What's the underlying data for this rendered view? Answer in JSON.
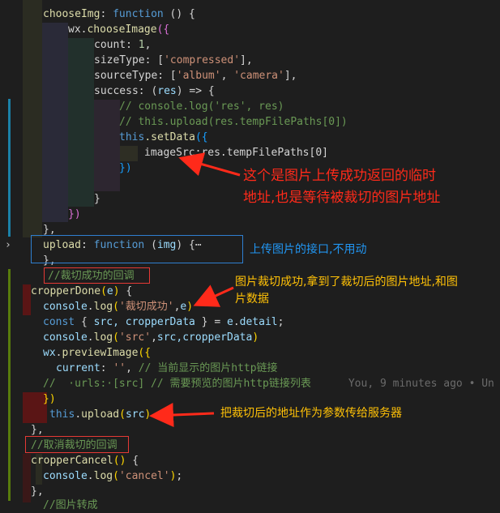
{
  "code": {
    "l1_name": "chooseImg",
    "l1_sep": ": ",
    "l1_kw": "function",
    "l1_rest": " () {",
    "l2_obj": "wx.",
    "l2_fn": "chooseImage",
    "l2_paren": "({",
    "l3_key": "count",
    "l3_val": "1",
    "l4_key": "sizeType",
    "l4_open": ": [",
    "l4_str": "'compressed'",
    "l4_close": "],",
    "l5_key": "sourceType",
    "l5_open": ": [",
    "l5_str1": "'album'",
    "l5_str2": "'camera'",
    "l5_close": "],",
    "l6_key": "success",
    "l6_sep": ": (",
    "l6_param": "res",
    "l6_arrow": ") => {",
    "l7_comment": "// console.log('res', res)",
    "l8_comment": "// this.upload(res.tempFilePaths[0])",
    "l9_this": "this",
    "l9_fn": ".setData",
    "l9_paren": "({",
    "l10_key": "imageSrc",
    "l10_val": ":res.tempFilePaths[0]",
    "l11": "})",
    "l13": "}",
    "l14": "})",
    "l15": "},",
    "l16_key": "upload",
    "l16_kw": "function",
    "l16_param": "img",
    "l16_rest": ") {⋯",
    "l17": "},",
    "l18_comment": "//裁切成功的回调",
    "l19_fn": "cropperDone",
    "l19_param": "e",
    "l20_obj": "console",
    "l20_fn": "log",
    "l20_str": "'裁切成功'",
    "l20_arg": "e",
    "l21_kw": "const",
    "l21_vars": "src, cropperData",
    "l21_obj": "e",
    "l21_prop": "detail",
    "l22_obj": "console",
    "l22_fn": "log",
    "l22_str": "'src'",
    "l22_args": "src,cropperData",
    "l23_obj": "wx",
    "l23_fn": "previewImage",
    "l24_key": "current",
    "l24_str": "''",
    "l24_comment": "// 当前显示的图片http链接",
    "l25_comment1": "//  ·urls:·[src]",
    "l25_comment2": " // 需要预览的图片http链接列表",
    "l25_blame": "You, 9 minutes ago • Un",
    "l26": "})",
    "l27_this": "this",
    "l27_fn": "upload",
    "l27_arg": "src",
    "l28": "},",
    "l29_comment": "//取消裁切的回调",
    "l30_fn": "cropperCancel",
    "l31_obj": "console",
    "l31_fn": "log",
    "l31_str": "'cancel'",
    "l32": "},",
    "l33_comment": "//图片转成"
  },
  "annotations": {
    "temp_path_1": "这个是图片上传成功返回的临时",
    "temp_path_2": "地址,也是等待被裁切的图片地址",
    "upload_api": "上传图片的接口,不用动",
    "crop_done_1": "图片裁切成功,拿到了裁切后的图片地址,和图",
    "crop_done_2": "片数据",
    "upload_param": "把裁切后的地址作为参数传给服务器"
  },
  "colors": {
    "editor_bg": "#1e1e1e",
    "annotation_red": "#ff2a1a",
    "annotation_blue": "#2196f3",
    "annotation_yellow": "#ffc107",
    "box_red": "#e53935",
    "box_blue": "#2f7fd0"
  },
  "icons": {
    "fold": "chevron-right-icon"
  }
}
